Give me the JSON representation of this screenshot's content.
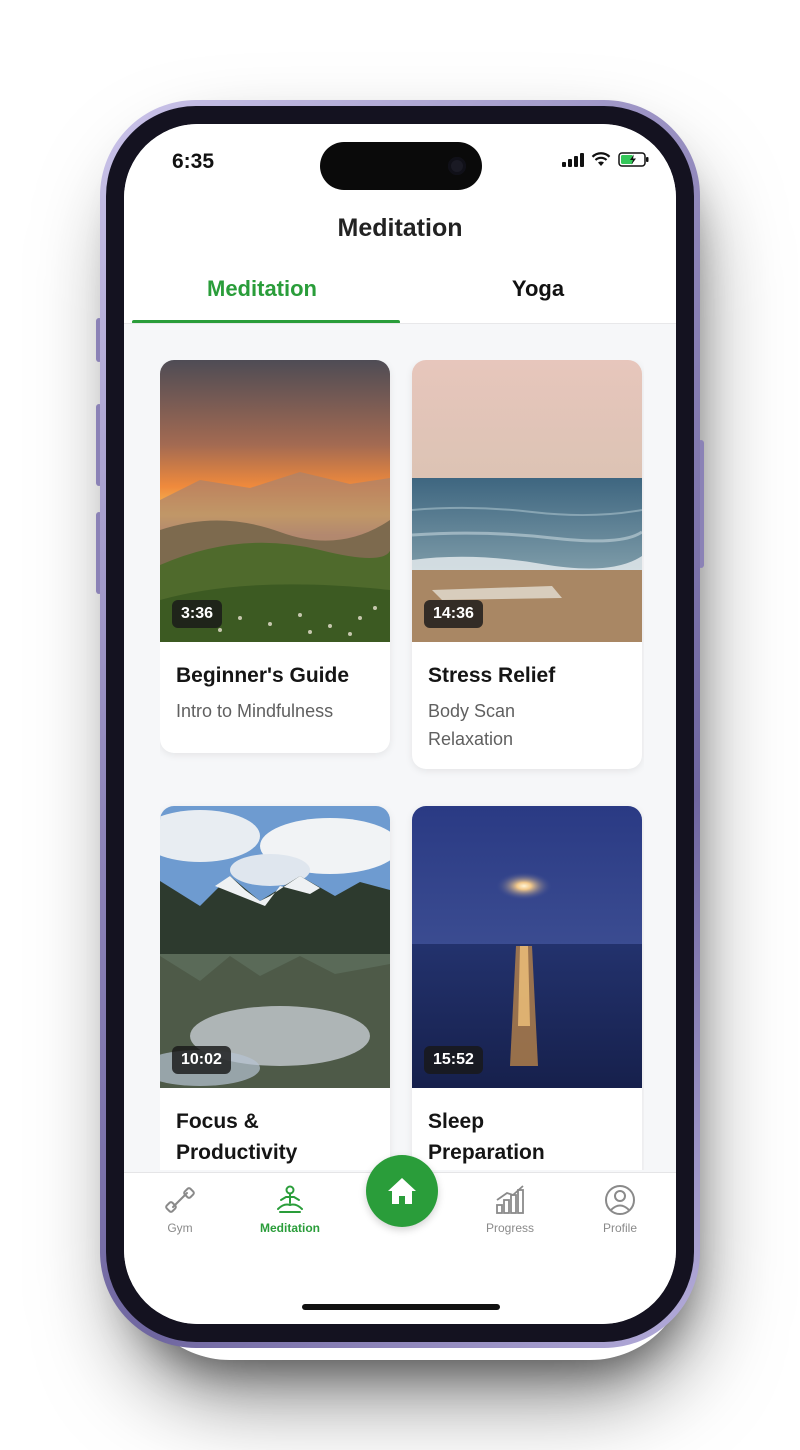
{
  "status_bar": {
    "time": "6:35"
  },
  "header": {
    "title": "Meditation"
  },
  "tabs": [
    {
      "label": "Meditation",
      "active": true
    },
    {
      "label": "Yoga",
      "active": false
    }
  ],
  "cards": [
    {
      "duration": "3:36",
      "title": "Beginner's Guide",
      "subtitle": "Intro to Mindfulness"
    },
    {
      "duration": "14:36",
      "title": "Stress Relief",
      "subtitle": "Body Scan Relaxation"
    },
    {
      "duration": "10:02",
      "title": "Focus & Productivity",
      "subtitle": ""
    },
    {
      "duration": "15:52",
      "title": "Sleep Preparation",
      "subtitle": ""
    }
  ],
  "bottom_nav": [
    {
      "label": "Gym",
      "icon": "dumbbell-icon",
      "active": false
    },
    {
      "label": "Meditation",
      "icon": "meditation-icon",
      "active": true
    },
    {
      "label": "",
      "icon": "home-icon",
      "active": false
    },
    {
      "label": "Progress",
      "icon": "chart-icon",
      "active": false
    },
    {
      "label": "Profile",
      "icon": "profile-icon",
      "active": false
    }
  ],
  "colors": {
    "accent": "#2a9d3a",
    "text": "#151515",
    "muted": "#606060"
  }
}
